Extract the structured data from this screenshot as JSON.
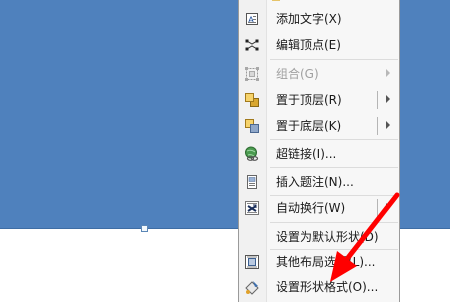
{
  "menu": {
    "items": [
      {
        "label": "添加文字(X)",
        "icon": "add-text-icon",
        "enabled": true
      },
      {
        "label": "编辑顶点(E)",
        "icon": "edit-points-icon",
        "enabled": true
      },
      {
        "label": "组合(G)",
        "icon": "group-icon",
        "enabled": false,
        "submenu": true
      },
      {
        "label": "置于顶层(R)",
        "icon": "bring-to-front-icon",
        "enabled": true,
        "submenu": true
      },
      {
        "label": "置于底层(K)",
        "icon": "send-to-back-icon",
        "enabled": true,
        "submenu": true
      },
      {
        "label": "超链接(I)...",
        "icon": "hyperlink-icon",
        "enabled": true
      },
      {
        "label": "插入题注(N)...",
        "icon": "insert-caption-icon",
        "enabled": true
      },
      {
        "label": "自动换行(W)",
        "icon": "text-wrap-icon",
        "enabled": true,
        "submenu": true
      },
      {
        "label": "设置为默认形状(D)",
        "icon": "",
        "enabled": true
      },
      {
        "label": "其他布局选项(L)...",
        "icon": "more-layout-icon",
        "enabled": true
      },
      {
        "label": "设置形状格式(O)...",
        "icon": "format-shape-icon",
        "enabled": true
      }
    ]
  },
  "colors": {
    "shape_fill": "#4f81bd",
    "annotation_arrow": "#ff0000"
  }
}
